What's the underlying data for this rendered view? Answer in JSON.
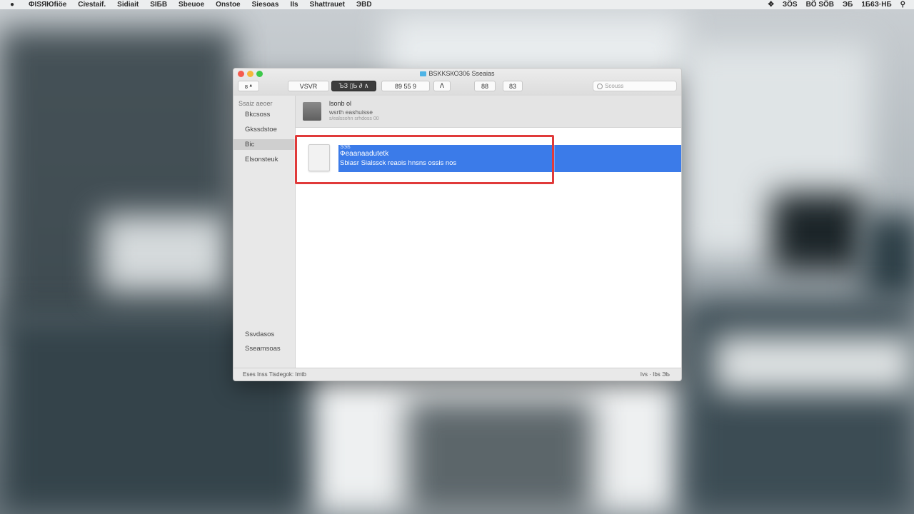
{
  "menubar": {
    "items": [
      "ФISЯЮfiöe",
      "Ciɐstaif.",
      "Sidiait",
      "SIБB",
      "Sbeuoe",
      "Onstoe",
      "Siesoas",
      "IIs",
      "Shattrauet",
      "ЭBD"
    ],
    "status_right": [
      "ЗÖS",
      "BÖ SÖB",
      "ЭБ",
      "1Б6З·НБ"
    ]
  },
  "window": {
    "title": "BSKKSКОЗ06 Sseaias",
    "toolbar": {
      "back_forward": "ᴕ ᵜ",
      "view_label": "VSVR",
      "active_tab": "ЪЗ ▯Ь ∂ ∧",
      "group_a": "89   55   9",
      "group_b": "ⴷ",
      "btn_c": "88",
      "btn_d": "83",
      "search_placeholder": "Scouss"
    },
    "sidebar": {
      "heading": "Ssaiz aeoer",
      "items": [
        "Bkcsoss",
        "Gkssdstoe",
        "Bic",
        "Elsonsteuk"
      ],
      "active_index": 2,
      "bottom_items": [
        "Ssvdasos",
        "Sseamsoas"
      ]
    },
    "info": {
      "title": "lsonb ol",
      "subtitle": "wsrth eashuisse",
      "detail": "s/ealssohn srhdoss 00"
    },
    "file": {
      "name_top": "ЭЭБ",
      "name": "Фeaanaadutetk",
      "meta": "Sbiasr Sialssck reaois hnsns ossis nos"
    },
    "statusbar": {
      "left": "Eses Inss Tisdegok: Imtb",
      "right": "Ivs · Ibs ЭЬ"
    }
  }
}
